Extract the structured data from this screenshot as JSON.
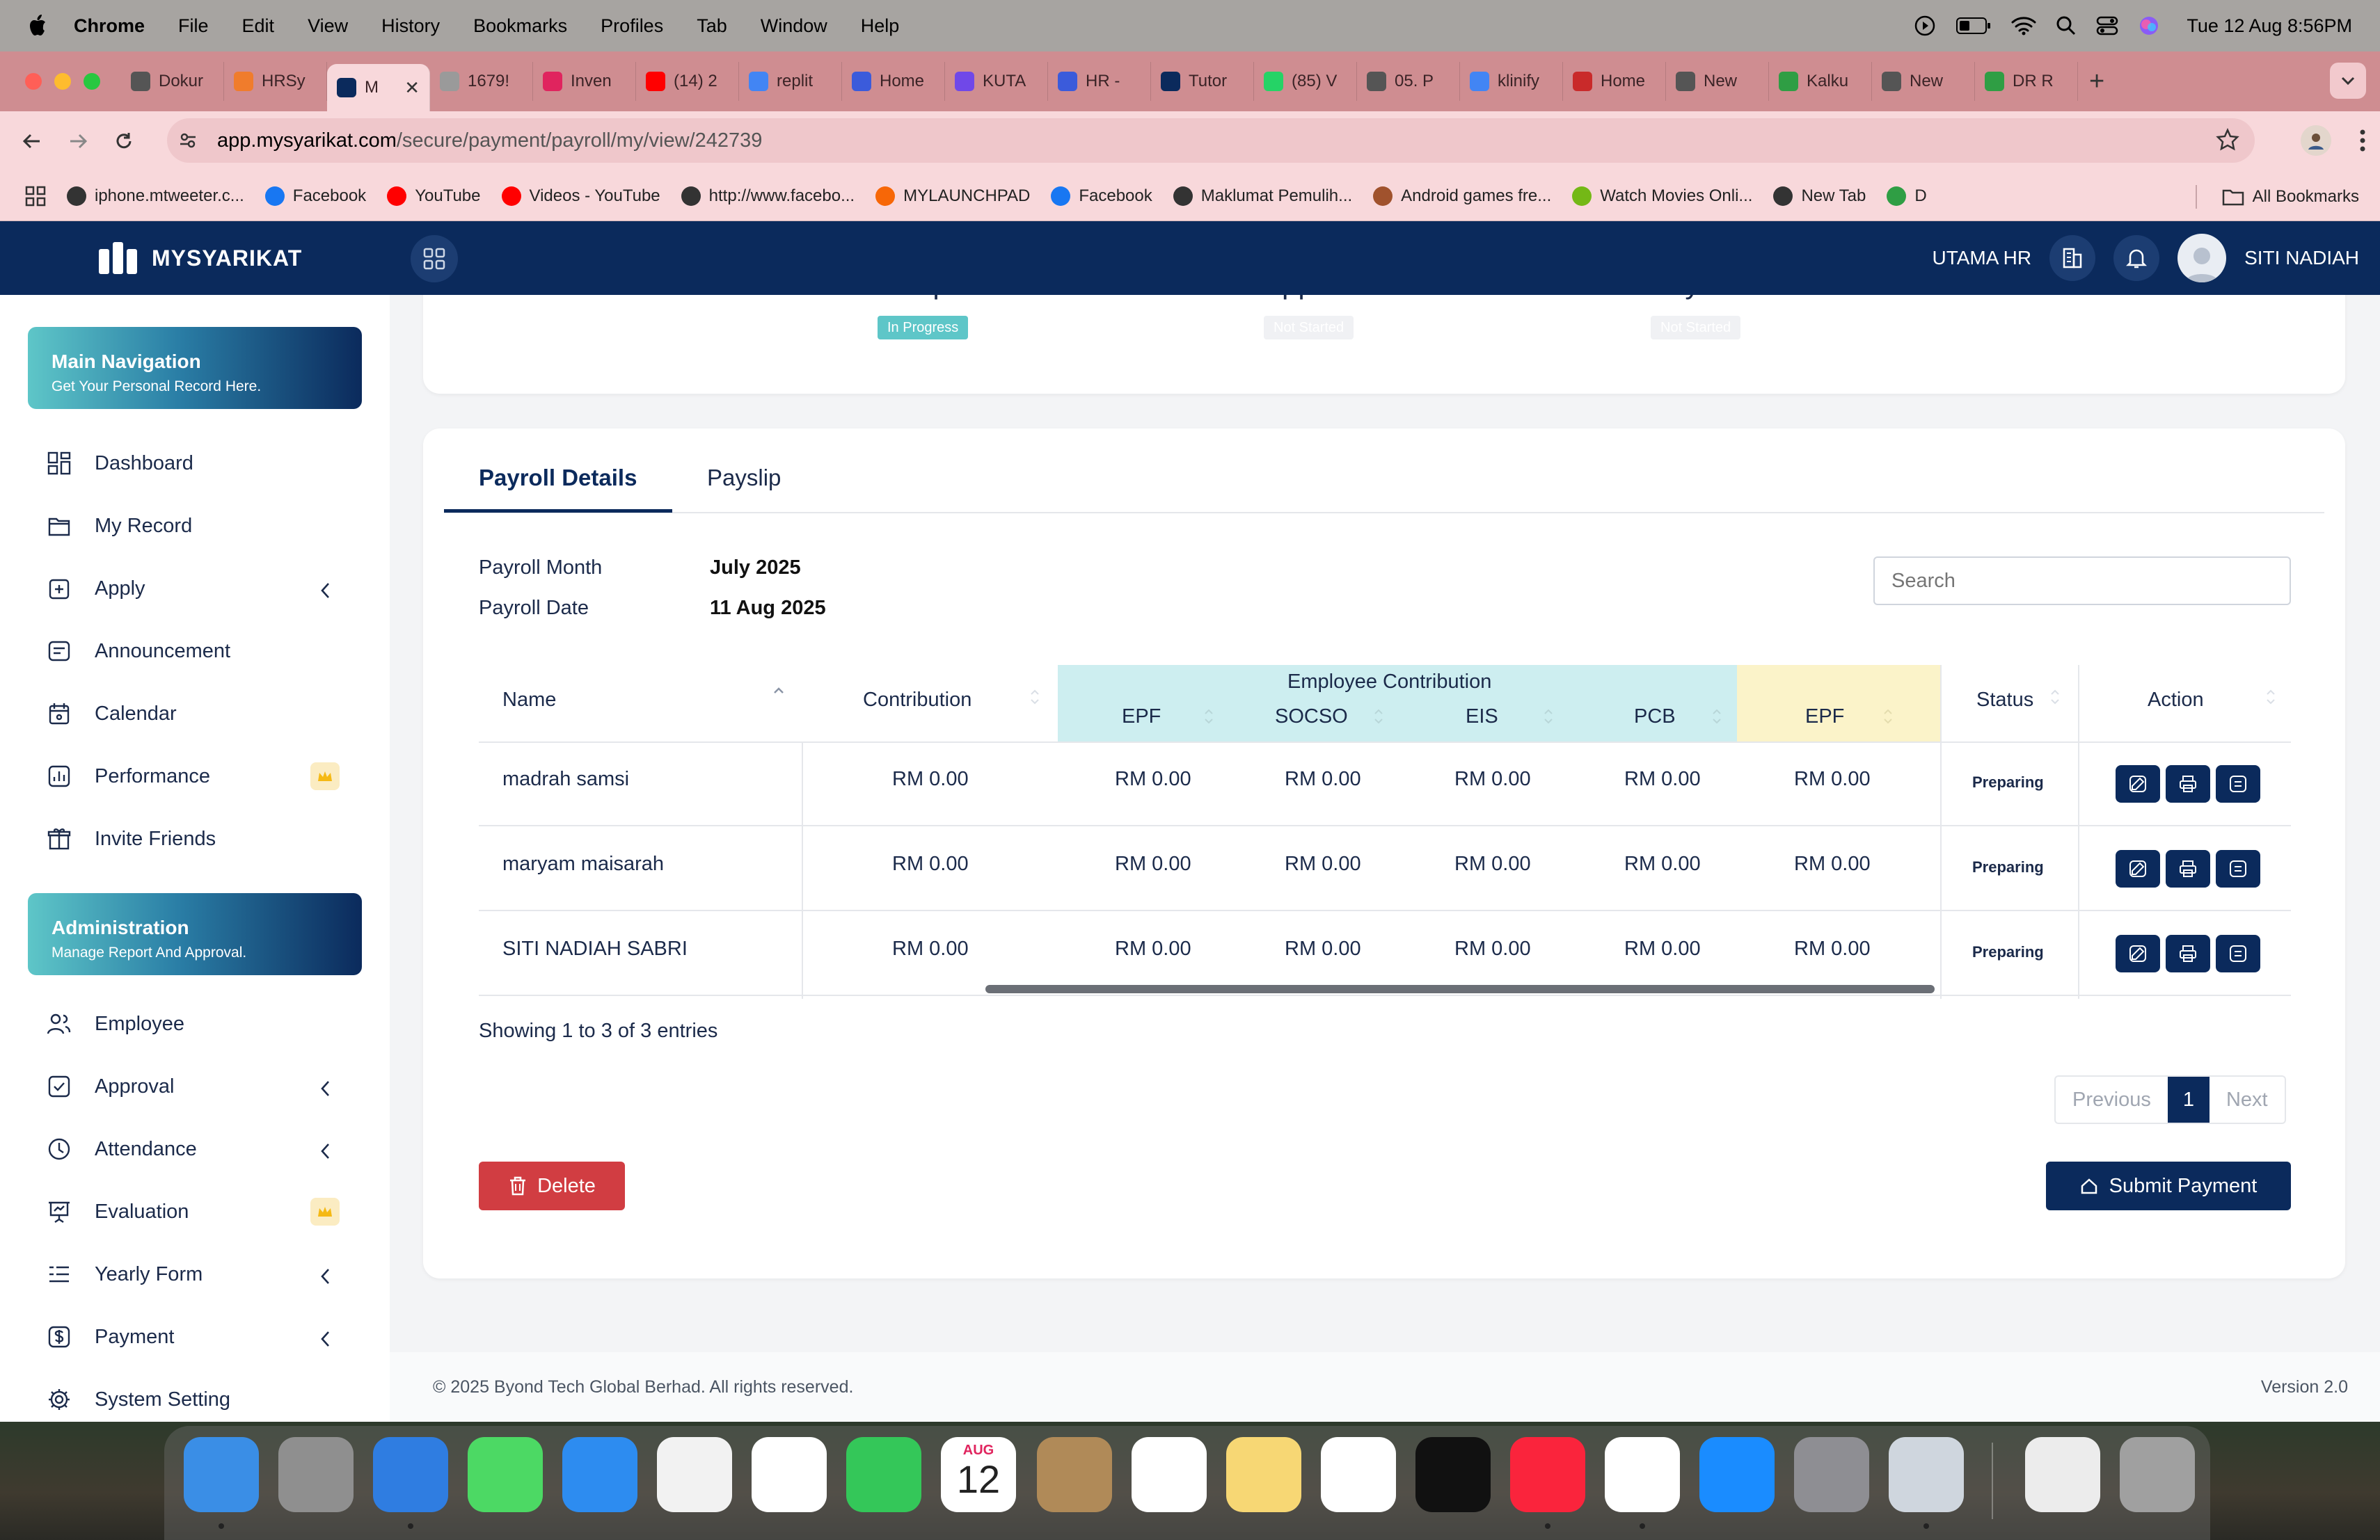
{
  "menubar": {
    "app": "Chrome",
    "items": [
      "File",
      "Edit",
      "View",
      "History",
      "Bookmarks",
      "Profiles",
      "Tab",
      "Window",
      "Help"
    ],
    "clock": "Tue 12 Aug  8:56PM"
  },
  "tabs": [
    {
      "label": "Dokur",
      "color": "#555555"
    },
    {
      "label": "HRSy",
      "color": "#f07c2c"
    },
    {
      "label": "M",
      "color": "#0b2a5c",
      "active": true
    },
    {
      "label": "1679!",
      "color": "#9a9a9a"
    },
    {
      "label": "Inven",
      "color": "#e0245e"
    },
    {
      "label": "(14) 2",
      "color": "#ff0000"
    },
    {
      "label": "replit",
      "color": "#4285f4"
    },
    {
      "label": "Home",
      "color": "#3b5bdb"
    },
    {
      "label": "KUTA",
      "color": "#7048e8"
    },
    {
      "label": "HR -",
      "color": "#3b5bdb"
    },
    {
      "label": "Tutor",
      "color": "#0b2a5c"
    },
    {
      "label": "(85) V",
      "color": "#25d366"
    },
    {
      "label": "05. P",
      "color": "#555555"
    },
    {
      "label": "klinify",
      "color": "#4285f4"
    },
    {
      "label": "Home",
      "color": "#c92a2a"
    },
    {
      "label": "New",
      "color": "#555555"
    },
    {
      "label": "Kalku",
      "color": "#2f9e44"
    },
    {
      "label": "New",
      "color": "#555555"
    },
    {
      "label": "DR R",
      "color": "#2f9e44"
    }
  ],
  "address": {
    "host": "app.mysyarikat.com",
    "path": "/secure/payment/payroll/my/view/242739"
  },
  "bookmarks": [
    {
      "label": "iphone.mtweeter.c...",
      "color": "#333333"
    },
    {
      "label": "Facebook",
      "color": "#1877f2"
    },
    {
      "label": "YouTube",
      "color": "#ff0000"
    },
    {
      "label": "Videos - YouTube",
      "color": "#ff0000"
    },
    {
      "label": "http://www.facebo...",
      "color": "#333333"
    },
    {
      "label": "MYLAUNCHPAD",
      "color": "#f76707"
    },
    {
      "label": "Facebook",
      "color": "#1877f2"
    },
    {
      "label": "Maklumat Pemulih...",
      "color": "#333333"
    },
    {
      "label": "Android games fre...",
      "color": "#a0522d"
    },
    {
      "label": "Watch Movies Onli...",
      "color": "#74b816"
    },
    {
      "label": "New Tab",
      "color": "#333333"
    },
    {
      "label": "D",
      "color": "#2f9e44"
    }
  ],
  "bookmarks_all": "All Bookmarks",
  "app": {
    "brand": "MYSYARIKAT",
    "company": "UTAMA HR",
    "user": "SITI NADIAH"
  },
  "sidebar": {
    "main_card": {
      "title": "Main Navigation",
      "subtitle": "Get Your Personal Record Here."
    },
    "main_items": [
      {
        "label": "Dashboard",
        "icon": "dashboard-icon"
      },
      {
        "label": "My Record",
        "icon": "folder-icon"
      },
      {
        "label": "Apply",
        "icon": "apply-icon",
        "chevron": true
      },
      {
        "label": "Announcement",
        "icon": "announcement-icon"
      },
      {
        "label": "Calendar",
        "icon": "calendar-icon"
      },
      {
        "label": "Performance",
        "icon": "performance-icon",
        "crown": true
      },
      {
        "label": "Invite Friends",
        "icon": "gift-icon"
      }
    ],
    "admin_card": {
      "title": "Administration",
      "subtitle": "Manage Report And Approval."
    },
    "admin_items": [
      {
        "label": "Employee",
        "icon": "users-icon"
      },
      {
        "label": "Approval",
        "icon": "check-square-icon",
        "chevron": true
      },
      {
        "label": "Attendance",
        "icon": "clock-icon",
        "chevron": true
      },
      {
        "label": "Evaluation",
        "icon": "presentation-icon",
        "crown": true
      },
      {
        "label": "Yearly Form",
        "icon": "list-icon",
        "chevron": true
      },
      {
        "label": "Payment",
        "icon": "dollar-icon",
        "chevron": true
      },
      {
        "label": "System Setting",
        "icon": "settings-icon"
      }
    ]
  },
  "steps": [
    {
      "title": "Update & Review",
      "badge": "In Progress",
      "badge_color": "#5ec6c8"
    },
    {
      "title": "Approval",
      "badge": "Not Started",
      "badge_color": "#eef0f3"
    },
    {
      "title": "Payment & Close",
      "badge": "Not Started",
      "badge_color": "#eef0f3"
    }
  ],
  "detail_tabs": [
    "Payroll Details",
    "Payslip"
  ],
  "meta": {
    "month_label": "Payroll Month",
    "month_value": "July 2025",
    "date_label": "Payroll Date",
    "date_value": "11 Aug 2025"
  },
  "search_placeholder": "Search",
  "table": {
    "headers": {
      "name": "Name",
      "contribution": "Contribution",
      "group": "Employee Contribution",
      "epf": "EPF",
      "socso": "SOCSO",
      "eis": "EIS",
      "pcb": "PCB",
      "epf2": "EPF",
      "status": "Status",
      "action": "Action"
    },
    "rows": [
      {
        "name": "madrah samsi",
        "contribution": "RM 0.00",
        "epf": "RM 0.00",
        "socso": "RM 0.00",
        "eis": "RM 0.00",
        "pcb": "RM 0.00",
        "epf2": "RM 0.00",
        "status": "Preparing"
      },
      {
        "name": "maryam maisarah",
        "contribution": "RM 0.00",
        "epf": "RM 0.00",
        "socso": "RM 0.00",
        "eis": "RM 0.00",
        "pcb": "RM 0.00",
        "epf2": "RM 0.00",
        "status": "Preparing"
      },
      {
        "name": "SITI NADIAH SABRI",
        "contribution": "RM 0.00",
        "epf": "RM 0.00",
        "socso": "RM 0.00",
        "eis": "RM 0.00",
        "pcb": "RM 0.00",
        "epf2": "RM 0.00",
        "status": "Preparing"
      }
    ]
  },
  "showing": "Showing 1 to 3 of 3 entries",
  "pager": {
    "prev": "Previous",
    "page": "1",
    "next": "Next"
  },
  "buttons": {
    "delete": "Delete",
    "submit": "Submit Payment"
  },
  "footer": {
    "copyright": "© 2025 Byond Tech Global Berhad. All rights reserved.",
    "version": "Version 2.0"
  },
  "colors": {
    "navy": "#0b2a5c",
    "teal": "#5ec6c8",
    "danger": "#d13d42",
    "group_bg": "#cdeef0",
    "epf2_bg": "#fbf3c9"
  },
  "dock": {
    "calendar_month": "AUG",
    "calendar_day": "12",
    "apps": [
      "finder-icon",
      "launchpad-icon",
      "safari-icon",
      "messages-icon",
      "mail-icon",
      "maps-icon",
      "photos-icon",
      "facetime-icon",
      "calendar-icon",
      "contacts-icon",
      "reminders-icon",
      "notes-icon",
      "freeform-icon",
      "tv-icon",
      "music-icon",
      "chrome-icon",
      "app-store-icon",
      "system-settings-icon",
      "iphone-mirroring-icon",
      "pdf-document-icon",
      "trash-icon"
    ]
  }
}
